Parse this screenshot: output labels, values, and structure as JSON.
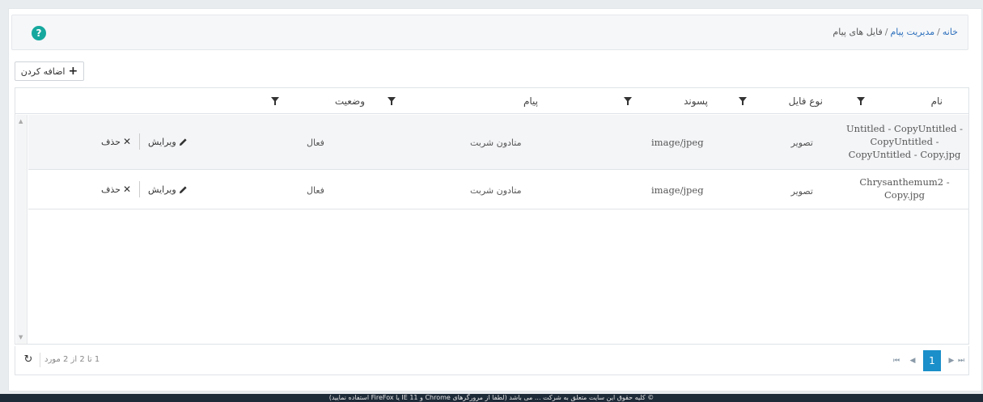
{
  "breadcrumb": {
    "home": "خانه",
    "section": "مدیریت پیام",
    "current": "فایل های پیام",
    "separator": "/"
  },
  "help": {
    "glyph": "?"
  },
  "toolbar": {
    "add_label": "اضافه کردن",
    "add_icon": "plus-icon"
  },
  "table": {
    "columns": [
      {
        "key": "name",
        "label": "نام"
      },
      {
        "key": "file_type",
        "label": "نوع فایل"
      },
      {
        "key": "extension",
        "label": "پسوند"
      },
      {
        "key": "message",
        "label": "پیام"
      },
      {
        "key": "status",
        "label": "وضعیت"
      }
    ],
    "rows": [
      {
        "name": "Untitled - CopyUntitled - CopyUntitled - CopyUntitled - Copy.jpg",
        "file_type": "تصویر",
        "extension": "image/jpeg",
        "message": "متادون شربت",
        "status": "فعال",
        "edit_label": "ویرایش",
        "delete_label": "حذف"
      },
      {
        "name": "Chrysanthemum2 - Copy.jpg",
        "file_type": "تصویر",
        "extension": "image/jpeg",
        "message": "متادون شربت",
        "status": "فعال",
        "edit_label": "ویرایش",
        "delete_label": "حذف"
      }
    ]
  },
  "pager": {
    "info": "1 تا 2 از 2 مورد",
    "current_page": "1",
    "first": "⏮",
    "prev": "◀",
    "next": "▶",
    "last": "⏭",
    "refresh": "↻"
  },
  "footer": {
    "text": "© کلیه حقوق این سایت متعلق به شرکت ... می باشد (لطفا از مرورگرهای Chrome و IE 11 یا FireFox استفاده نمایید)"
  },
  "colors": {
    "accent": "#1a8fc9",
    "help_badge": "#16a89e",
    "footer_bg": "#1d2a38",
    "link": "#2a6ebb"
  }
}
